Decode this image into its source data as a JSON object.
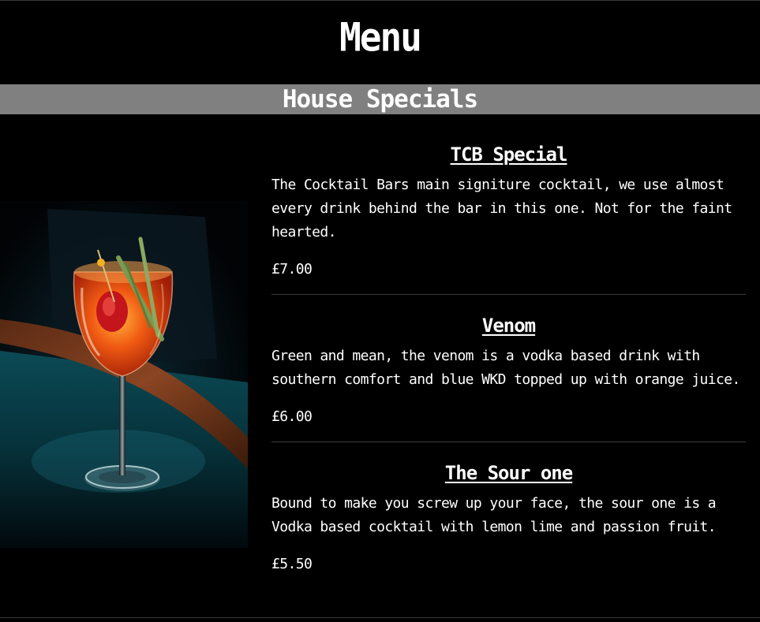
{
  "page": {
    "title": "Menu"
  },
  "section": {
    "title": "House Specials"
  },
  "photo": {
    "description_icon": "cocktail-glass-photo"
  },
  "items": [
    {
      "name": "TCB Special",
      "description": "The Cocktail Bars main signiture cocktail, we use almost every drink behind the bar in this one. Not for the faint hearted.",
      "price": "£7.00"
    },
    {
      "name": "Venom",
      "description": "Green and mean, the venom is a vodka based drink with southern comfort and blue WKD topped up with orange juice.",
      "price": "£6.00"
    },
    {
      "name": "The Sour one",
      "description": "Bound to make you screw up your face, the sour one is a Vodka based cocktail with lemon lime and passion fruit.",
      "price": "£5.50"
    }
  ],
  "colors": {
    "background": "#000000",
    "section_band": "#808080",
    "text": "#ffffff",
    "divider": "#3c3c3c"
  }
}
